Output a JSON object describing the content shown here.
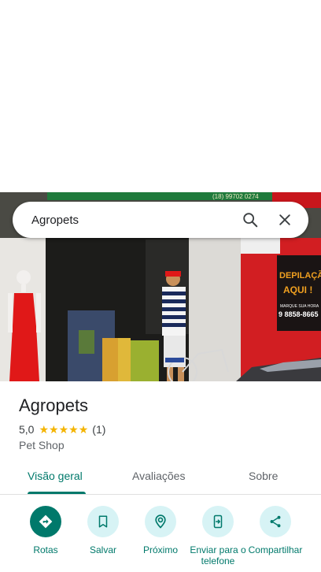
{
  "search": {
    "query": "Agropets"
  },
  "photo": {
    "sign_text": "(18) 99702 0274",
    "shop_sign_line1": "DEPILAÇÃO",
    "shop_sign_line2": "AQUI !",
    "shop_sign_line3": "MARQUE SUA HORA",
    "shop_sign_phone": "9 8858-8665"
  },
  "place": {
    "name": "Agropets",
    "rating": "5,0",
    "stars": 5,
    "review_count": "(1)",
    "category": "Pet Shop"
  },
  "tabs": [
    {
      "label": "Visão geral",
      "active": true
    },
    {
      "label": "Avaliações",
      "active": false
    },
    {
      "label": "Sobre",
      "active": false
    }
  ],
  "actions": [
    {
      "label": "Rotas",
      "icon": "directions-icon"
    },
    {
      "label": "Salvar",
      "icon": "bookmark-icon"
    },
    {
      "label": "Próximo",
      "icon": "nearby-icon"
    },
    {
      "label": "Enviar para o telefone",
      "icon": "send-to-phone-icon"
    },
    {
      "label": "Compartilhar",
      "icon": "share-icon"
    }
  ],
  "colors": {
    "accent": "#00796b",
    "action_bg": "#d7f3f5",
    "star": "#f4b400"
  }
}
